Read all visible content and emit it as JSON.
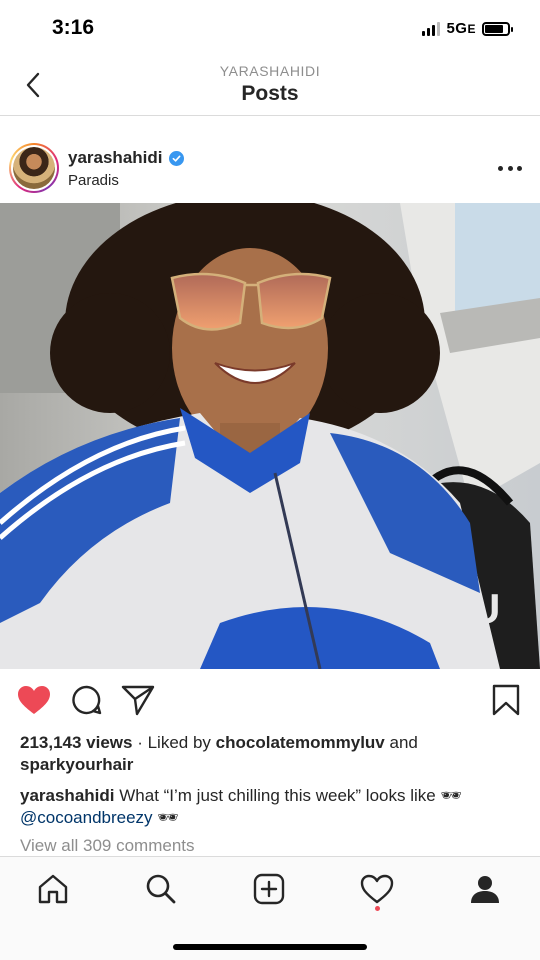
{
  "status_bar": {
    "time": "3:16",
    "network": "5G",
    "network_suffix": "E",
    "signal_bars": 3,
    "signal_bars_total": 4,
    "battery_level": 0.8
  },
  "header": {
    "subtitle": "YARASHAHIDI",
    "title": "Posts",
    "back_icon": "chevron-left-icon"
  },
  "post": {
    "username": "yarashahidi",
    "verified": true,
    "location": "Paradis",
    "more_icon": "more-horizontal-icon",
    "liked": true,
    "colors": {
      "like": "#ed4956",
      "verified": "#3897f0",
      "mention": "#003569",
      "muted": "#8e8e8e"
    },
    "views_count": "213,143 views",
    "liked_by_prefix": "· Liked by",
    "liked_by_user": "chocolatemommyluv",
    "liked_by_and": "and",
    "liked_by_user2": "sparkyourhair",
    "caption_user": "yarashahidi",
    "caption_text": "What “I’m just chilling this week” looks like 🕶",
    "caption_mention": "@cocoandbreezy",
    "caption_emoji": "🕶",
    "view_comments": "View all 309 comments"
  },
  "tab_bar": {
    "items": [
      "home-icon",
      "search-icon",
      "new-post-icon",
      "activity-heart-icon",
      "profile-icon"
    ],
    "activity_has_notification": true
  }
}
